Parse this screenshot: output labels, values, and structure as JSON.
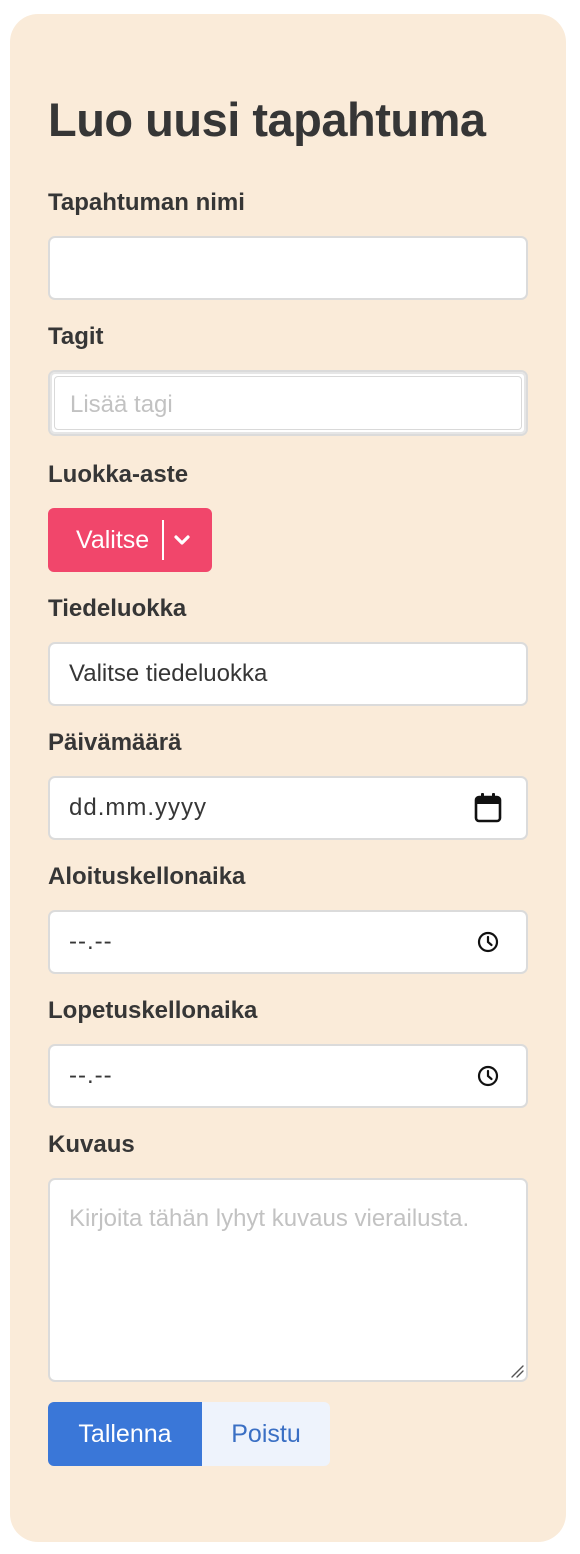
{
  "form": {
    "title": "Luo uusi tapahtuma",
    "event_name": {
      "label": "Tapahtuman nimi",
      "value": ""
    },
    "tags": {
      "label": "Tagit",
      "placeholder": "Lisää tagi"
    },
    "grade": {
      "label": "Luokka-aste",
      "button_label": "Valitse",
      "icon": "chevron-down-icon"
    },
    "science": {
      "label": "Tiedeluokka",
      "value": "Valitse tiedeluokka"
    },
    "date": {
      "label": "Päivämäärä",
      "value": "dd.mm.yyyy",
      "icon": "calendar-icon"
    },
    "start_time": {
      "label": "Aloituskellonaika",
      "value": "--.--",
      "icon": "clock-icon"
    },
    "end_time": {
      "label": "Lopetuskellonaika",
      "value": "--.--",
      "icon": "clock-icon"
    },
    "description": {
      "label": "Kuvaus",
      "placeholder": "Kirjoita tähän lyhyt kuvaus vierailusta."
    },
    "buttons": {
      "save": "Tallenna",
      "exit": "Poistu"
    }
  },
  "colors": {
    "card_background": "#faebd9",
    "select_button": "#f1466b",
    "primary_button": "#3a77d8",
    "secondary_button": "#eef3fc"
  }
}
